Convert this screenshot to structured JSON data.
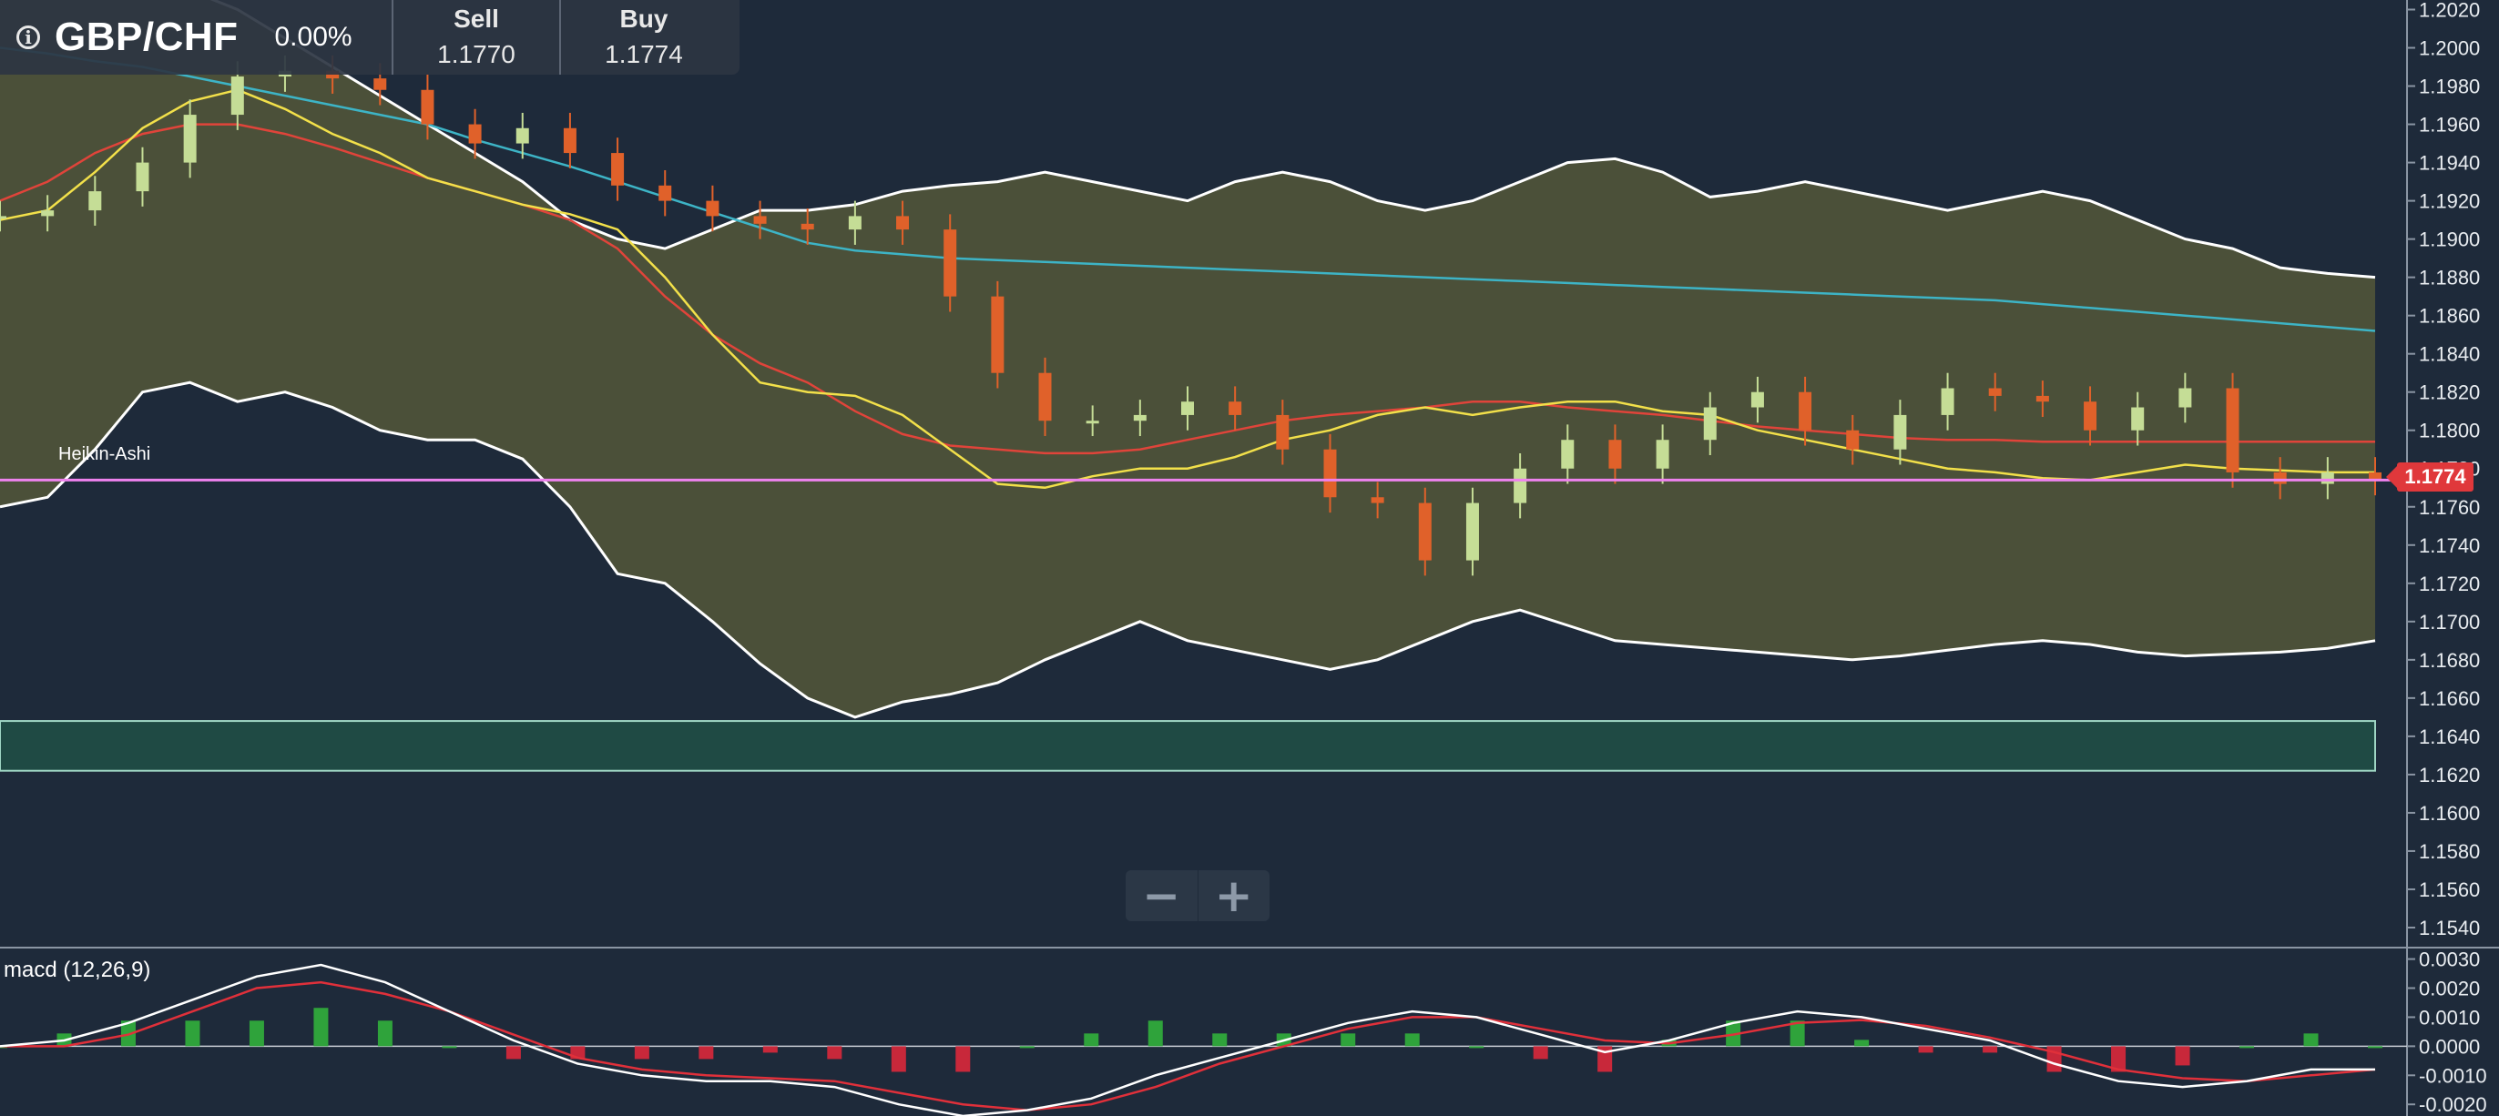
{
  "header": {
    "info_icon": "info-icon",
    "symbol": "GBP/CHF",
    "change": "0.00%",
    "sell_label": "Sell",
    "sell_price": "1.1770",
    "buy_label": "Buy",
    "buy_price": "1.1774"
  },
  "zoom": {
    "out_label": "−",
    "in_label": "+"
  },
  "indicator_label": "Heikin-Ashi",
  "macd_label": "macd (12,26,9)",
  "current_price": "1.1774",
  "colors": {
    "background": "#1e2a3a",
    "band_fill": "#4e5239",
    "up_candle": "#c5dd96",
    "down_candle": "#e0612a",
    "price_line": "#ee82ee",
    "tag": "#e0383b"
  },
  "chart_data": [
    {
      "type": "line",
      "subtype": "candlestick-heikin-ashi",
      "x": [
        0,
        5,
        10,
        15,
        20,
        25,
        30,
        35,
        40,
        45,
        50,
        55,
        60,
        65,
        70,
        75,
        80,
        85,
        90,
        95,
        100,
        105,
        110,
        115,
        120,
        125,
        130,
        135,
        140,
        145,
        150,
        155,
        160,
        165,
        170,
        175,
        180,
        185,
        190,
        195,
        200,
        205,
        210,
        215,
        220,
        225,
        230,
        235,
        240,
        245,
        250
      ],
      "y_ticks": [
        "1.2020",
        "1.2000",
        "1.1980",
        "1.1960",
        "1.1940",
        "1.1920",
        "1.1900",
        "1.1880",
        "1.1860",
        "1.1840",
        "1.1820",
        "1.1800",
        "1.1780",
        "1.1760",
        "1.1740",
        "1.1720",
        "1.1700",
        "1.1680",
        "1.1660",
        "1.1640",
        "1.1620",
        "1.1600",
        "1.1580",
        "1.1560",
        "1.1540"
      ],
      "ylim": [
        1.153,
        1.2025
      ],
      "series": [
        {
          "close": [
            1.1912,
            1.1915,
            1.1925,
            1.194,
            1.1965,
            1.1985,
            1.1988,
            1.1984,
            1.1978,
            1.196,
            1.195,
            1.1958,
            1.1945,
            1.1928,
            1.192,
            1.1912,
            1.1908,
            1.1905,
            1.1912,
            1.1905,
            1.187,
            1.183,
            1.1805,
            1.1805,
            1.1808,
            1.1815,
            1.1808,
            1.179,
            1.1765,
            1.1762,
            1.1732,
            1.1762,
            1.178,
            1.1795,
            1.178,
            1.1795,
            1.1812,
            1.182,
            1.18,
            1.179,
            1.1808,
            1.1822,
            1.1818,
            1.1815,
            1.18,
            1.1812,
            1.1822,
            1.1778,
            1.1772,
            1.1778,
            1.1774
          ]
        },
        {
          "values": [
            1.191,
            1.1915,
            1.1935,
            1.1958,
            1.1972,
            1.1978,
            1.1968,
            1.1955,
            1.1945,
            1.1932,
            1.1925,
            1.1918,
            1.1913,
            1.1905,
            1.188,
            1.185,
            1.1825,
            1.182,
            1.1818,
            1.1808,
            1.179,
            1.1772,
            1.177,
            1.1776,
            1.178,
            1.178,
            1.1786,
            1.1795,
            1.18,
            1.1808,
            1.1812,
            1.1808,
            1.1812,
            1.1815,
            1.1815,
            1.181,
            1.1808,
            1.18,
            1.1795,
            1.179,
            1.1785,
            1.178,
            1.1778,
            1.1775,
            1.1774,
            1.1778,
            1.1782,
            1.178,
            1.1779,
            1.1778,
            1.1778
          ]
        },
        {
          "values": [
            1.192,
            1.193,
            1.1945,
            1.1955,
            1.196,
            1.196,
            1.1955,
            1.1948,
            1.194,
            1.1932,
            1.1925,
            1.1918,
            1.191,
            1.1895,
            1.187,
            1.185,
            1.1835,
            1.1825,
            1.181,
            1.1798,
            1.1792,
            1.179,
            1.1788,
            1.1788,
            1.179,
            1.1795,
            1.18,
            1.1805,
            1.1808,
            1.181,
            1.1812,
            1.1815,
            1.1815,
            1.1812,
            1.181,
            1.1808,
            1.1805,
            1.1802,
            1.18,
            1.1798,
            1.1796,
            1.1795,
            1.1795,
            1.1794,
            1.1794,
            1.1794,
            1.1794,
            1.1794,
            1.1794,
            1.1794,
            1.1794
          ]
        },
        {
          "values": [
            1.2,
            1.1997,
            1.1993,
            1.199,
            1.1985,
            1.198,
            1.1975,
            1.197,
            1.1965,
            1.196,
            1.1952,
            1.1945,
            1.1938,
            1.193,
            1.1922,
            1.1914,
            1.1906,
            1.1898,
            1.1894,
            1.1892,
            1.189,
            1.1889,
            1.1888,
            1.1887,
            1.1886,
            1.1885,
            1.1884,
            1.1883,
            1.1882,
            1.1881,
            1.188,
            1.1879,
            1.1878,
            1.1877,
            1.1876,
            1.1875,
            1.1874,
            1.1873,
            1.1872,
            1.1871,
            1.187,
            1.1869,
            1.1868,
            1.1866,
            1.1864,
            1.1862,
            1.186,
            1.1858,
            1.1856,
            1.1854,
            1.1852
          ]
        },
        {
          "upper": [
            1.207,
            1.207,
            1.207,
            1.205,
            1.203,
            1.202,
            1.2005,
            1.199,
            1.1975,
            1.196,
            1.1945,
            1.193,
            1.191,
            1.19,
            1.1895,
            1.1905,
            1.1915,
            1.1915,
            1.1918,
            1.1925,
            1.1928,
            1.193,
            1.1935,
            1.193,
            1.1925,
            1.192,
            1.193,
            1.1935,
            1.193,
            1.192,
            1.1915,
            1.192,
            1.193,
            1.194,
            1.1942,
            1.1935,
            1.1922,
            1.1925,
            1.193,
            1.1925,
            1.192,
            1.1915,
            1.192,
            1.1925,
            1.192,
            1.191,
            1.19,
            1.1895,
            1.1885,
            1.1882,
            1.188
          ],
          "lower": [
            1.176,
            1.1765,
            1.179,
            1.182,
            1.1825,
            1.1815,
            1.182,
            1.1812,
            1.18,
            1.1795,
            1.1795,
            1.1785,
            1.176,
            1.1725,
            1.172,
            1.17,
            1.1678,
            1.166,
            1.165,
            1.1658,
            1.1662,
            1.1668,
            1.168,
            1.169,
            1.17,
            1.169,
            1.1685,
            1.168,
            1.1675,
            1.168,
            1.169,
            1.17,
            1.1706,
            1.1698,
            1.169,
            1.1688,
            1.1686,
            1.1684,
            1.1682,
            1.168,
            1.1682,
            1.1685,
            1.1688,
            1.169,
            1.1688,
            1.1684,
            1.1682,
            1.1683,
            1.1684,
            1.1686,
            1.169
          ]
        }
      ],
      "current_price": 1.1774
    },
    {
      "type": "line",
      "subtype": "macd",
      "y_ticks": [
        "0.0030",
        "0.0020",
        "0.0010",
        "0.0000",
        "-0.0010",
        "-0.0020"
      ],
      "ylim": [
        -0.0024,
        0.0033
      ],
      "series": [
        {
          "values": [
            0.0,
            0.0002,
            0.0008,
            0.0016,
            0.0024,
            0.0028,
            0.0022,
            0.0012,
            0.0002,
            -0.0006,
            -0.001,
            -0.0012,
            -0.0012,
            -0.0014,
            -0.002,
            -0.0024,
            -0.0022,
            -0.0018,
            -0.001,
            -0.0004,
            0.0002,
            0.0008,
            0.0012,
            0.001,
            0.0004,
            -0.0002,
            0.0002,
            0.0008,
            0.0012,
            0.001,
            0.0006,
            0.0002,
            -0.0006,
            -0.0012,
            -0.0014,
            -0.0012,
            -0.0008,
            -0.0008
          ]
        },
        {
          "values": [
            0.0,
            0.0,
            0.0004,
            0.0012,
            0.002,
            0.0022,
            0.0018,
            0.0012,
            0.0004,
            -0.0004,
            -0.0008,
            -0.001,
            -0.0011,
            -0.0012,
            -0.0016,
            -0.002,
            -0.0022,
            -0.002,
            -0.0014,
            -0.0006,
            0.0,
            0.0006,
            0.001,
            0.001,
            0.0006,
            0.0002,
            0.0001,
            0.0004,
            0.0008,
            0.0009,
            0.0007,
            0.0003,
            -0.0002,
            -0.0008,
            -0.0011,
            -0.0012,
            -0.001,
            -0.0008
          ]
        }
      ]
    }
  ]
}
